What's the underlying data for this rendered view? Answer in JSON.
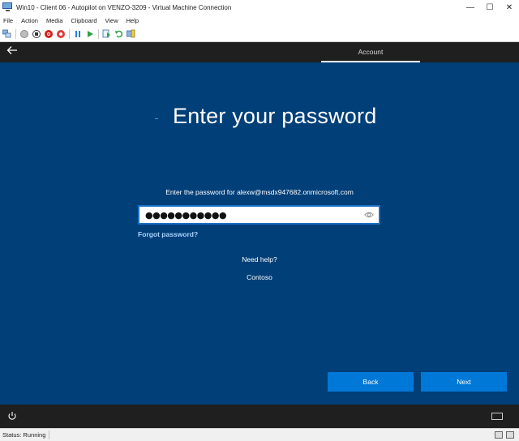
{
  "window": {
    "title": "Win10 - Client 06 - Autopilot on VENZO-3209 - Virtual Machine Connection",
    "controls": {
      "minimize": "—",
      "maximize": "☐",
      "close": "✕"
    }
  },
  "menubar": {
    "items": [
      "File",
      "Action",
      "Media",
      "Clipboard",
      "View",
      "Help"
    ]
  },
  "toolbar": {
    "buttons": [
      "ctrl-alt-del-icon",
      "start-icon",
      "turn-off-icon",
      "shutdown-icon",
      "save-icon",
      "pause-icon",
      "resume-icon",
      "checkpoint-icon",
      "revert-icon",
      "enhanced-session-icon"
    ]
  },
  "vm": {
    "top_tab": "Account",
    "heading": "Enter your password",
    "prompt": "Enter the password for alexw@msdx947682.onmicrosoft.com",
    "password_value": "●●●●●●●●●●●",
    "forgot_link": "Forgot password?",
    "need_help": "Need help?",
    "org_name": "Contoso",
    "back_button": "Back",
    "next_button": "Next",
    "colors": {
      "background": "#013f78",
      "accent": "#0078d7",
      "link": "#a9d4ff",
      "bar": "#1f1f1f"
    }
  },
  "statusbar": {
    "status": "Status: Running"
  }
}
